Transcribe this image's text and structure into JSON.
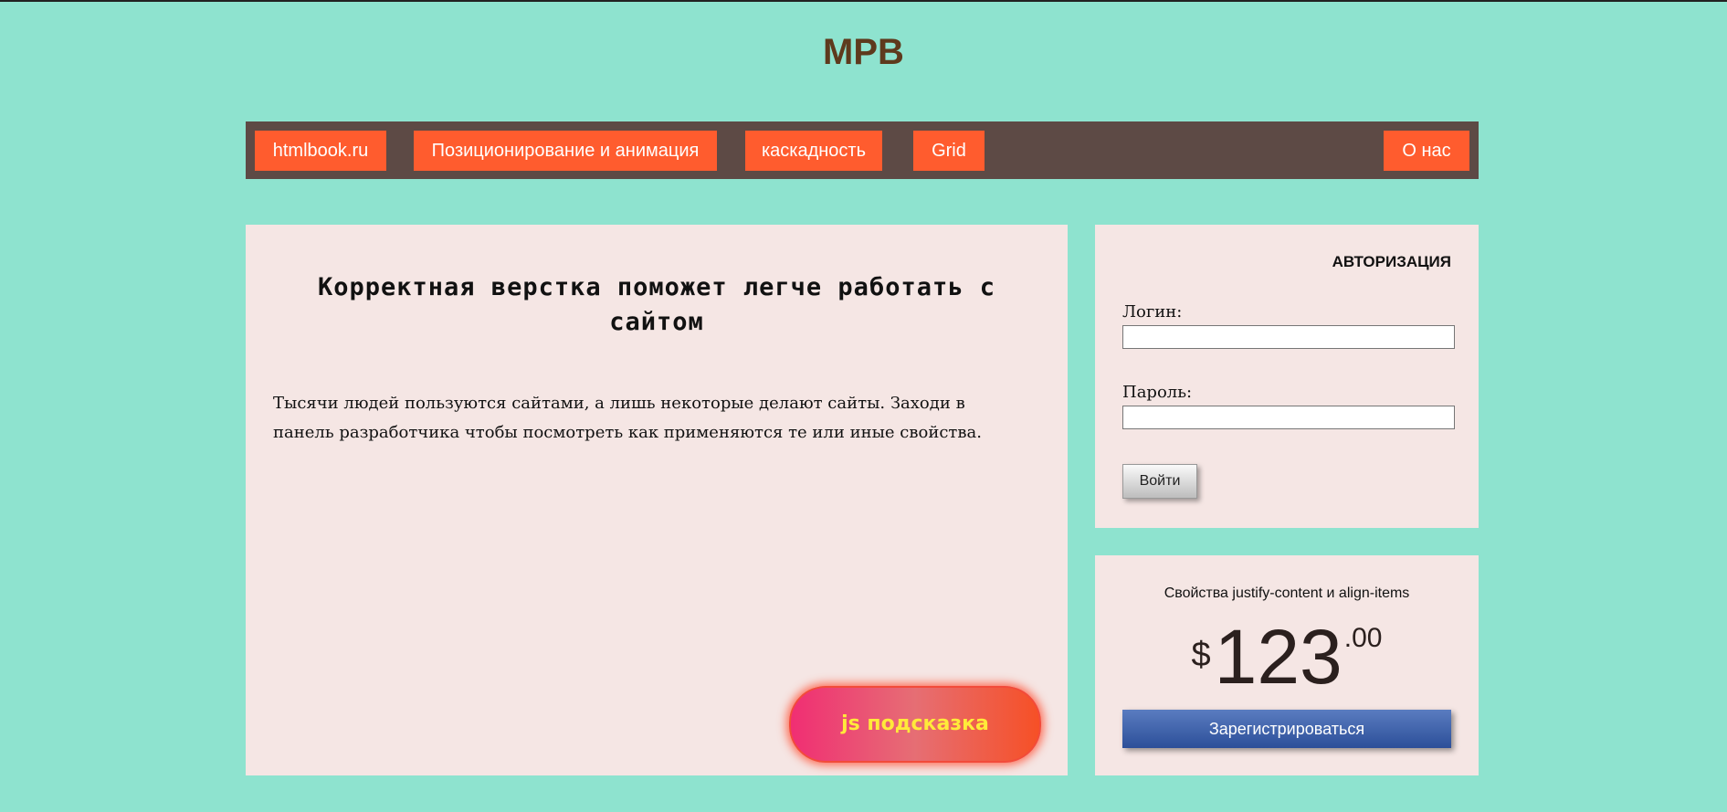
{
  "site": {
    "title": "MPB"
  },
  "nav": {
    "items": [
      {
        "label": "htmlbook.ru"
      },
      {
        "label": "Позиционирование и анимация"
      },
      {
        "label": "каскадность"
      },
      {
        "label": "Grid"
      },
      {
        "label": "О нас"
      }
    ]
  },
  "main": {
    "heading": "Корректная верстка поможет легче работать с сайтом",
    "text": "Тысячи людей пользуются сайтами, а лишь некоторые делают сайты. Заходи в панель разработчика чтобы посмотреть как применяются те или иные свойства.",
    "hint_button": "js подсказка"
  },
  "auth": {
    "title": "АВТОРИЗАЦИЯ",
    "login_label": "Логин:",
    "login_value": "",
    "password_label": "Пароль:",
    "password_value": "",
    "submit_label": "Войти"
  },
  "price": {
    "caption": "Свойства justify-content и align-items",
    "currency": "$",
    "amount": "123",
    "cents": ".00",
    "button_label": "Зарегистрироваться"
  },
  "colors": {
    "background": "#8ee3cf",
    "title": "#5e3a1d",
    "navbar": "#5d4a45",
    "nav_item": "#ff5c2e",
    "panel": "#f5e6e4",
    "hint_text": "#ffea3a",
    "register_button": "#2c4f99"
  }
}
